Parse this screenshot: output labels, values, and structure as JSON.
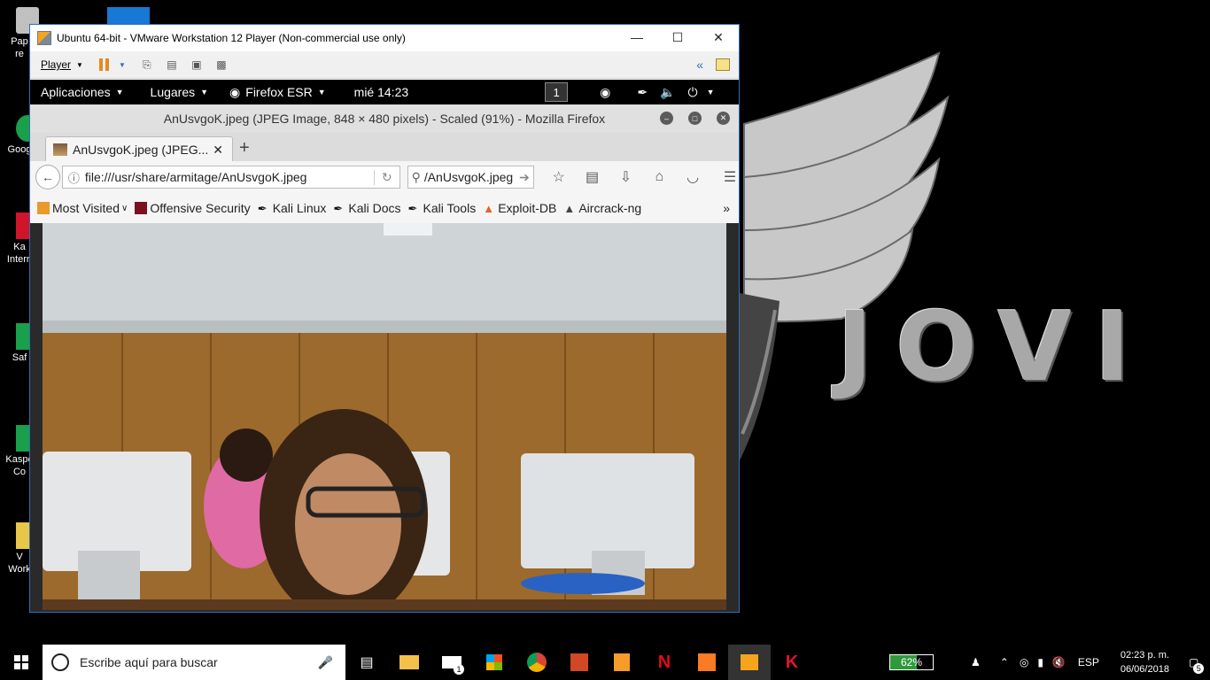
{
  "desktop": {
    "wallpaper_text": "JOVI",
    "icons": [
      {
        "label": "Pap\nre",
        "color": "#c0c0c0"
      },
      {
        "label": "Goog",
        "color": "#1a9f4a"
      },
      {
        "label": "Ka\nIntern",
        "color": "#d0142a"
      },
      {
        "label": "Saf",
        "color": "#1a9f4a"
      },
      {
        "label": "Kaspe\nCo",
        "color": "#1a9f4a"
      },
      {
        "label": "V\nWork",
        "color": "#e8c64a"
      }
    ]
  },
  "vmware": {
    "title": "Ubuntu 64-bit - VMware Workstation 12 Player (Non-commercial use only)",
    "player_menu": "Player"
  },
  "gnome": {
    "applications": "Aplicaciones",
    "places": "Lugares",
    "app": "Firefox ESR",
    "clock": "mié 14:23",
    "workspace": "1"
  },
  "firefox": {
    "window_title": "AnUsvgoK.jpeg (JPEG Image, 848 × 480 pixels) - Scaled (91%) - Mozilla Firefox",
    "tab_title": "AnUsvgoK.jpeg (JPEG...",
    "url": "file:///usr/share/armitage/AnUsvgoK.jpeg",
    "search_value": "/AnUsvgoK.jpeg",
    "bookmarks": [
      {
        "label": "Most Visited",
        "icon": "most-visited-icon",
        "dropdown": true
      },
      {
        "label": "Offensive Security",
        "icon": "offsec-icon"
      },
      {
        "label": "Kali Linux",
        "icon": "kali-icon"
      },
      {
        "label": "Kali Docs",
        "icon": "kali-icon"
      },
      {
        "label": "Kali Tools",
        "icon": "kali-icon"
      },
      {
        "label": "Exploit-DB",
        "icon": "exploitdb-icon"
      },
      {
        "label": "Aircrack-ng",
        "icon": "aircrack-icon"
      }
    ]
  },
  "taskbar": {
    "search_placeholder": "Escribe aquí para buscar",
    "battery_percent": "62%",
    "language": "ESP",
    "time": "02:23 p. m.",
    "date": "06/06/2018",
    "mail_badge": "1",
    "notifications_badge": "5"
  },
  "colors": {
    "vmware_border": "#2e6fb6",
    "battery_fill": "#2e9a3c",
    "taskbar_bg": "#000000"
  }
}
